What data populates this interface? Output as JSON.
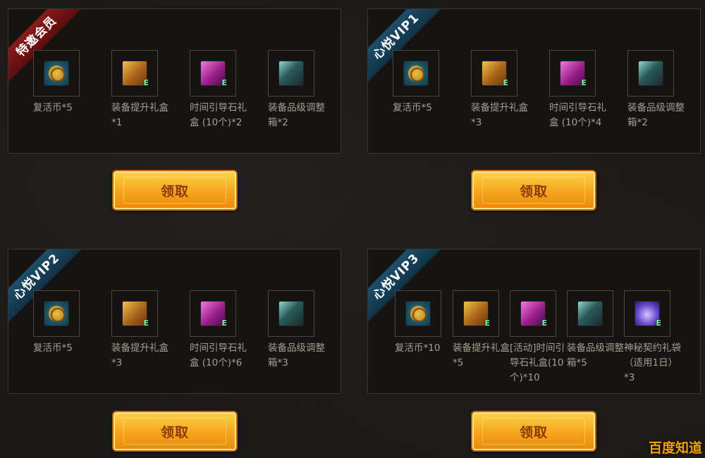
{
  "panels": [
    {
      "ribbon": "特邀会员",
      "ribbon_color": "#7a1414",
      "items": [
        {
          "icon": "revive-coin-icon",
          "label": "复活币*5"
        },
        {
          "icon": "gold-chest-icon",
          "label": "装备提升礼盒*1"
        },
        {
          "icon": "pink-chest-icon",
          "label": "时间引导石礼盒 (10个)*2"
        },
        {
          "icon": "dark-box-icon",
          "label": "装备品级调整箱*2"
        }
      ],
      "button": "领取"
    },
    {
      "ribbon": "心悦VIP1",
      "ribbon_color": "#174460",
      "items": [
        {
          "icon": "revive-coin-icon",
          "label": "复活币*5"
        },
        {
          "icon": "gold-chest-icon",
          "label": "装备提升礼盒*3"
        },
        {
          "icon": "pink-chest-icon",
          "label": "时间引导石礼盒 (10个)*4"
        },
        {
          "icon": "dark-box-icon",
          "label": "装备品级调整箱*2"
        }
      ],
      "button": "领取"
    },
    {
      "ribbon": "心悦VIP2",
      "ribbon_color": "#174460",
      "items": [
        {
          "icon": "revive-coin-icon",
          "label": "复活币*5"
        },
        {
          "icon": "gold-chest-icon",
          "label": "装备提升礼盒*3"
        },
        {
          "icon": "pink-chest-icon",
          "label": "时间引导石礼盒 (10个)*6"
        },
        {
          "icon": "dark-box-icon",
          "label": "装备品级调整箱*3"
        }
      ],
      "button": "领取"
    },
    {
      "ribbon": "心悦VIP3",
      "ribbon_color": "#174460",
      "items": [
        {
          "icon": "revive-coin-icon",
          "label": "复活币*10"
        },
        {
          "icon": "gold-chest-icon",
          "label": "装备提升礼盒*5"
        },
        {
          "icon": "pink-chest-icon",
          "label": "[活动]时间引导石礼盒(10个)*10"
        },
        {
          "icon": "dark-box-icon",
          "label": "装备品级调整箱*5"
        },
        {
          "icon": "mystic-bag-icon",
          "label": "神秘契约礼袋（适用1日）*3"
        }
      ],
      "button": "领取"
    }
  ],
  "watermark": "百度知道"
}
